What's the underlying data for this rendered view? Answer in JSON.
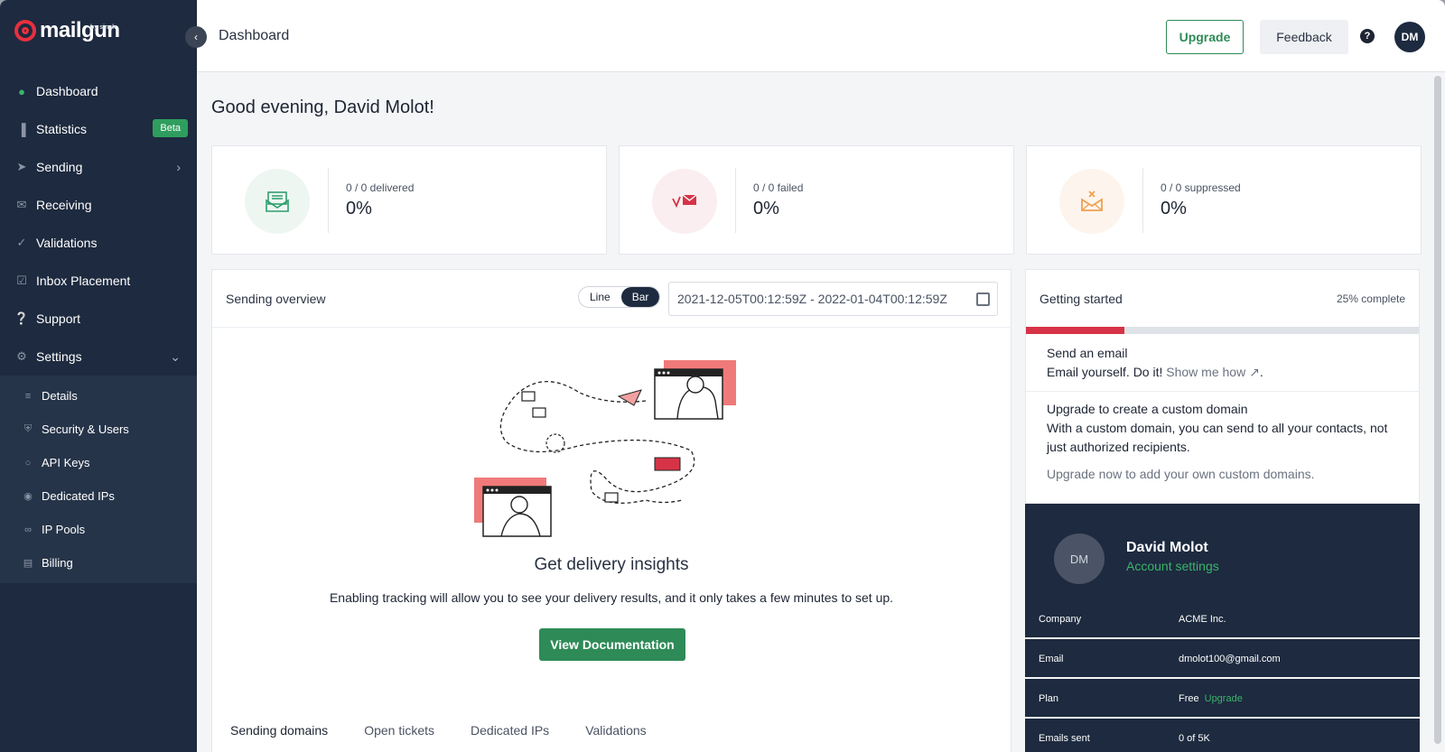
{
  "brand": {
    "name": "mailgun",
    "tagline": "by sinch"
  },
  "sidebar": {
    "items": [
      {
        "label": "Dashboard"
      },
      {
        "label": "Statistics",
        "badge": "Beta"
      },
      {
        "label": "Sending"
      },
      {
        "label": "Receiving"
      },
      {
        "label": "Validations"
      },
      {
        "label": "Inbox Placement"
      },
      {
        "label": "Support"
      },
      {
        "label": "Settings"
      }
    ],
    "settings_sub": [
      {
        "label": "Details"
      },
      {
        "label": "Security & Users"
      },
      {
        "label": "API Keys"
      },
      {
        "label": "Dedicated IPs"
      },
      {
        "label": "IP Pools"
      },
      {
        "label": "Billing"
      }
    ]
  },
  "topbar": {
    "title": "Dashboard",
    "upgrade_label": "Upgrade",
    "feedback_label": "Feedback",
    "help_glyph": "?",
    "avatar_initials": "DM"
  },
  "greeting": "Good evening, David Molot!",
  "stats": [
    {
      "label": "0 / 0 delivered",
      "value": "0%",
      "color": "#2e9e6e",
      "tint": "#eef7f2"
    },
    {
      "label": "0 / 0 failed",
      "value": "0%",
      "color": "#d63347",
      "tint": "#fdf0f1"
    },
    {
      "label": "0 / 0 suppressed",
      "value": "0%",
      "color": "#f0a050",
      "tint": "#fef5ec"
    }
  ],
  "overview": {
    "title": "Sending overview",
    "toggle": [
      "Line",
      "Bar"
    ],
    "selected": "Bar",
    "date_range": "2021-12-05T00:12:59Z - 2022-01-04T00:12:59Z",
    "empty_title": "Get delivery insights",
    "empty_text": "Enabling tracking will allow you to see your delivery results, and it only takes a few minutes to set up.",
    "cta_label": "View Documentation",
    "tabs": [
      "Sending domains",
      "Open tickets",
      "Dedicated IPs",
      "Validations"
    ]
  },
  "getting_started": {
    "title": "Getting started",
    "percent_label": "25% complete",
    "progress": 0.25,
    "step1_title": "Send an email",
    "step1_text": "Email yourself. Do it!",
    "step1_link": "Show me how",
    "step2_title": "Upgrade to create a custom domain",
    "step2_text": "With a custom domain, you can send to all your contacts, not just authorized recipients.",
    "step2_note": "Upgrade now to add your own custom domains."
  },
  "profile": {
    "initials": "DM",
    "name": "David Molot",
    "link": "Account settings",
    "rows": [
      {
        "key": "Company",
        "value": "ACME Inc."
      },
      {
        "key": "Email",
        "value": "dmolot100@gmail.com"
      },
      {
        "key": "Plan",
        "value": "Free",
        "action": "Upgrade"
      },
      {
        "key": "Emails sent",
        "value": "0 of 5K"
      }
    ]
  },
  "colors": {
    "sidebar": "#1d2a3f",
    "accent": "#2e8b57",
    "danger": "#d63347"
  }
}
